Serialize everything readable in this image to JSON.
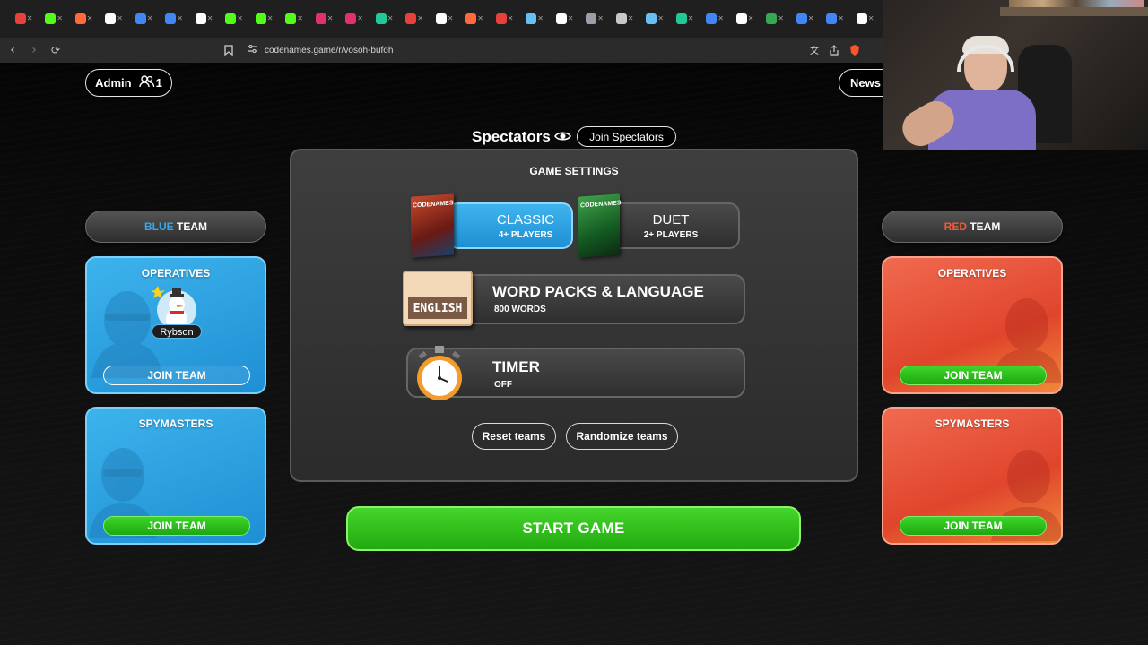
{
  "browser": {
    "url": "codenames.game/r/vosoh-bufoh",
    "tab_favicons": [
      "#e8413c",
      "#53fc18",
      "#ff6a3d",
      "#ffffff",
      "#4285f4",
      "#4285f4",
      "#ffffff",
      "#53fc18",
      "#53fc18",
      "#53fc18",
      "#e1306c",
      "#e1306c",
      "#20c997",
      "#e8413c",
      "#ffffff",
      "#ff6a3d",
      "#e8413c",
      "#66c0f4",
      "#ffffff",
      "#9aa0a6",
      "#c8c8c8",
      "#66c0f4",
      "#20c997",
      "#4285f4",
      "#ffffff",
      "#34a853",
      "#4285f4",
      "#4285f4",
      "#ffffff"
    ]
  },
  "header": {
    "admin_label": "Admin",
    "player_count": "1",
    "news_label": "News"
  },
  "spectators": {
    "title": "Spectators",
    "join_label": "Join Spectators"
  },
  "blue_team": {
    "name_colored": "BLUE",
    "name_rest": " TEAM",
    "color": "#3aa7e6",
    "operatives": {
      "title": "OPERATIVES",
      "players": [
        "Rybson"
      ],
      "join_label": "JOIN TEAM"
    },
    "spymasters": {
      "title": "SPYMASTERS",
      "join_label": "JOIN TEAM"
    }
  },
  "red_team": {
    "name_colored": "RED",
    "name_rest": " TEAM",
    "color": "#ef5a3c",
    "operatives": {
      "title": "OPERATIVES",
      "join_label": "JOIN TEAM"
    },
    "spymasters": {
      "title": "SPYMASTERS",
      "join_label": "JOIN TEAM"
    }
  },
  "settings": {
    "title": "GAME SETTINGS",
    "modes": [
      {
        "name": "CLASSIC",
        "players": "4+ PLAYERS",
        "selected": true
      },
      {
        "name": "DUET",
        "players": "2+ PLAYERS",
        "selected": false
      }
    ],
    "box_brand": "CODENAMES",
    "word_packs": {
      "title": "WORD PACKS & LANGUAGE",
      "sub": "800 WORDS",
      "badge": "ENGLISH"
    },
    "timer": {
      "title": "TIMER",
      "sub": "OFF"
    },
    "reset_label": "Reset teams",
    "randomize_label": "Randomize teams"
  },
  "start_label": "START GAME",
  "colors": {
    "green": "#2cbe18",
    "blue": "#2a9ee0",
    "red": "#e8503a"
  }
}
